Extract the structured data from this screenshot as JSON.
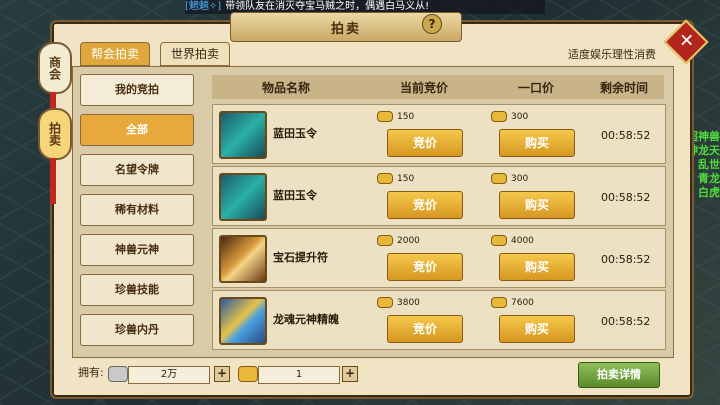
{
  "broadcast": {
    "sender": "[魍魎✧]",
    "message": "带领队友在消灭夺宝马贼之时，偶遇白马义从!"
  },
  "window": {
    "title": "拍卖",
    "help": "?",
    "close": "✕"
  },
  "side_tabs": [
    {
      "label": "商会"
    },
    {
      "label": "拍卖"
    }
  ],
  "top_tabs": [
    {
      "label": "帮会拍卖"
    },
    {
      "label": "世界拍卖"
    }
  ],
  "motto": "适度娱乐理性消费",
  "sidebar": {
    "items": [
      {
        "label": "我的竞拍"
      },
      {
        "label": "全部"
      },
      {
        "label": "名望令牌"
      },
      {
        "label": "稀有材料"
      },
      {
        "label": "神兽元神"
      },
      {
        "label": "珍兽技能"
      },
      {
        "label": "珍兽内丹"
      }
    ]
  },
  "table": {
    "headers": [
      "物品名称",
      "当前竞价",
      "一口价",
      "剩余时间"
    ],
    "rows": [
      {
        "name": "蓝田玉令",
        "bid": "150",
        "buyout": "300",
        "bid_btn": "竞价",
        "buy_btn": "购买",
        "time": "00:58:52",
        "icon": "jade-token-icon"
      },
      {
        "name": "蓝田玉令",
        "bid": "150",
        "buyout": "300",
        "bid_btn": "竞价",
        "buy_btn": "购买",
        "time": "00:58:52",
        "icon": "jade-token-icon"
      },
      {
        "name": "宝石提升符",
        "bid": "2000",
        "buyout": "4000",
        "bid_btn": "竞价",
        "buy_btn": "购买",
        "time": "00:58:52",
        "icon": "scroll-icon"
      },
      {
        "name": "龙魂元神精魄",
        "bid": "3800",
        "buyout": "7600",
        "bid_btn": "竞价",
        "buy_btn": "购买",
        "time": "00:58:52",
        "icon": "chest-icon"
      }
    ]
  },
  "footer": {
    "own_label": "拥有:",
    "silver": "2万",
    "gold": "1",
    "plus": "+",
    "detail_button": "拍卖详情"
  },
  "scene_text": {
    "npc_lines": [
      "超神兽",
      "神龙天",
      "乱世",
      "青龙",
      "白虎"
    ]
  }
}
